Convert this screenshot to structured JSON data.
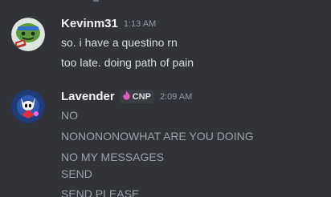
{
  "messages": [
    {
      "author": "Kevinm31",
      "timestamp": "1:13 AM",
      "avatar_icon": "green-cat-avatar-icon",
      "lines": [
        "so. i have a questino rn",
        "too late. doing path of pain"
      ]
    },
    {
      "author": "Lavender",
      "timestamp": "2:09 AM",
      "avatar_icon": "knight-avatar-icon",
      "tag": {
        "label": "CNP",
        "icon": "flame-icon",
        "icon_color": "#e25fc2"
      },
      "lines": [
        "NO",
        "NONONONOWHAT ARE YOU DOING",
        "NO MY MESSAGES",
        "SEND",
        "SEND PLEASE"
      ]
    }
  ]
}
